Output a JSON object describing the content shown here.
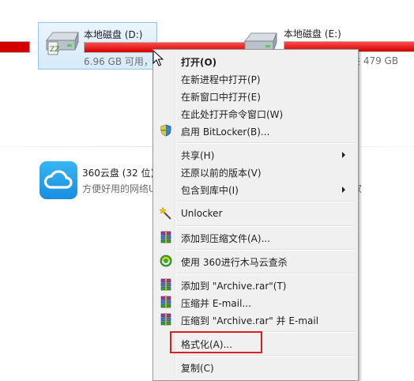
{
  "drives": {
    "d": {
      "name": "本地磁盘 (D:)",
      "free": "6.96 GB 可用，",
      "used_fraction": 1.0
    },
    "e": {
      "name": "本地磁盘 (E:)",
      "free": "共 479 GB",
      "used_fraction": 1.0
    }
  },
  "apps": {
    "cloud": {
      "name": "360云盘 (32 位)",
      "desc": "方便好用的网络U",
      "desc_tail": "家"
    }
  },
  "menu": {
    "items": [
      {
        "label": "打开(O)",
        "bold": true
      },
      {
        "label": "在新进程中打开(P)"
      },
      {
        "label": "在新窗口中打开(E)"
      },
      {
        "label": "在此处打开命令窗口(W)"
      },
      {
        "label": "启用 BitLocker(B)...",
        "icon": "bitlocker-shield-icon"
      },
      {
        "label": "共享(H)",
        "submenu": true
      },
      {
        "label": "还原以前的版本(V)"
      },
      {
        "label": "包含到库中(I)",
        "submenu": true
      },
      {
        "label": "Unlocker",
        "icon": "unlocker-wand-icon"
      },
      {
        "label": "添加到压缩文件(A)...",
        "icon": "winrar-icon"
      },
      {
        "label": "使用 360进行木马云查杀",
        "icon": "360-scan-icon"
      },
      {
        "label": "添加到 \"Archive.rar\"(T)",
        "icon": "winrar-icon"
      },
      {
        "label": "压缩并 E-mail...",
        "icon": "winrar-icon"
      },
      {
        "label": "压缩到 \"Archive.rar\" 并 E-mail",
        "icon": "winrar-icon"
      },
      {
        "label": "格式化(A)..."
      },
      {
        "label": "复制(C)"
      }
    ]
  },
  "colors": {
    "usage_bar": "#d40000",
    "highlight_box": "#d9201f",
    "menu_bg": "#f0f0f0"
  }
}
